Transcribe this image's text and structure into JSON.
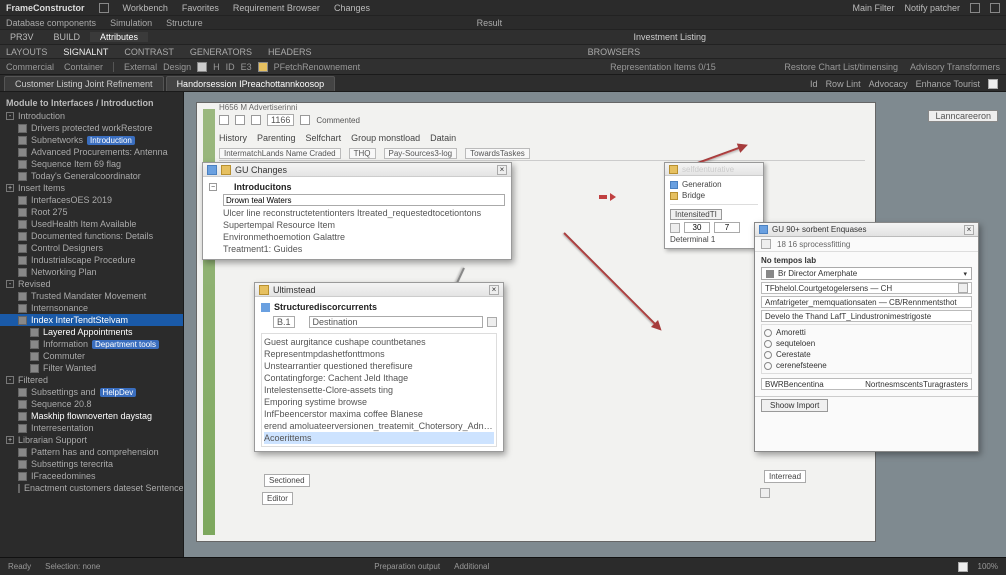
{
  "menubar": {
    "app": "FrameConstructor",
    "items": [
      "Workbench",
      "Favorites",
      "Requirement Browser",
      "Changes"
    ],
    "right": [
      "Main Filter",
      "Notify patcher"
    ]
  },
  "ribbon": {
    "items": [
      "Database components",
      "Simulation",
      "Structure"
    ],
    "center": "Result"
  },
  "secondary": {
    "leftTabs": [
      "PR3V",
      "BUILD",
      "Attributes"
    ],
    "rightLabel": "Investment Listing"
  },
  "catbar": {
    "items": [
      "LAYOUTS",
      "SIGNALNT",
      "CONTRAST",
      "GENERATORS",
      "HEADERS"
    ],
    "center": "BROWSERS"
  },
  "toolrow": {
    "left": [
      "Commercial",
      "Container"
    ],
    "center": [
      "External",
      "Design",
      "H",
      "ID",
      "E3",
      "PFetchRenownement"
    ],
    "mid": "Representation Items 0/15",
    "right": [
      "Restore Chart List/timensing",
      "Advisory Transformers"
    ]
  },
  "tabstrip": {
    "tabs": [
      {
        "label": "Customer Listing Joint Refinement",
        "active": false
      },
      {
        "label": "Handorsession IPreachottannkoosop",
        "active": true
      }
    ],
    "rightlinks": [
      "Id",
      "Row Lint",
      "Advocacy",
      "Enhance Tourist"
    ]
  },
  "leftpanel": {
    "title": "Module to Interfaces / Introduction",
    "rows": [
      {
        "t": "section",
        "label": "Introduction",
        "expand": "-"
      },
      {
        "t": "row",
        "indent": 1,
        "label": "Drivers protected workRestore"
      },
      {
        "t": "row",
        "indent": 1,
        "label": "Subnetworks",
        "badge": "Introduction"
      },
      {
        "t": "row",
        "indent": 1,
        "label": "Advanced Procurements: Antenna"
      },
      {
        "t": "row",
        "indent": 1,
        "label": "Sequence Item   69 flag"
      },
      {
        "t": "row",
        "indent": 1,
        "label": "Today's Generalcoordinator"
      },
      {
        "t": "section",
        "label": "Insert Items",
        "expand": "+"
      },
      {
        "t": "row",
        "indent": 1,
        "label": "InterfacesOES 2019"
      },
      {
        "t": "row",
        "indent": 1,
        "label": "Root 275"
      },
      {
        "t": "row",
        "indent": 1,
        "label": "UsedHealth Item Available"
      },
      {
        "t": "row",
        "indent": 1,
        "label": "Documented functions: Details"
      },
      {
        "t": "row",
        "indent": 1,
        "label": "Control Designers"
      },
      {
        "t": "row",
        "indent": 1,
        "label": "Industrialscape Procedure"
      },
      {
        "t": "row",
        "indent": 1,
        "label": "Networking Plan"
      },
      {
        "t": "section",
        "label": "Revised",
        "expand": "-"
      },
      {
        "t": "row",
        "indent": 1,
        "label": "Trusted Mandater Movement"
      },
      {
        "t": "row",
        "indent": 1,
        "label": "Internsonance"
      },
      {
        "t": "row",
        "indent": 1,
        "sel": true,
        "label": "Index  InterTendtStelvam"
      },
      {
        "t": "row",
        "indent": 2,
        "hl": true,
        "label": "Layered   Appointments"
      },
      {
        "t": "row",
        "indent": 2,
        "label": "Information",
        "badge": "Department tools"
      },
      {
        "t": "row",
        "indent": 2,
        "label": "Commuter"
      },
      {
        "t": "row",
        "indent": 2,
        "label": "Filter Wanted"
      },
      {
        "t": "section",
        "label": "Filtered",
        "expand": "-"
      },
      {
        "t": "row",
        "indent": 1,
        "label": "Subsettings and",
        "badge": "HelpDev"
      },
      {
        "t": "row",
        "indent": 1,
        "label": "Sequence  20.8"
      },
      {
        "t": "row",
        "indent": 1,
        "label": "Maskhip flownoverten daystag",
        "hl": true
      },
      {
        "t": "row",
        "indent": 1,
        "label": "Interresentation"
      },
      {
        "t": "section",
        "label": "Librarian Support",
        "expand": "+"
      },
      {
        "t": "row",
        "indent": 1,
        "label": "Pattern has and comprehension"
      },
      {
        "t": "row",
        "indent": 1,
        "label": "Subsettings terecrita"
      },
      {
        "t": "row",
        "indent": 1,
        "label": "IFraceedomines"
      },
      {
        "t": "row",
        "indent": 1,
        "label": "Enactment customers dateset Sentence"
      }
    ]
  },
  "document": {
    "title": "H656 M Advertiserinni",
    "toolbarItems": [
      "",
      "",
      "",
      "1166",
      "",
      "Commented"
    ],
    "menubar": [
      "History",
      "Parenting",
      "Selfchart",
      "Group monstload",
      "Datain"
    ],
    "subbar": [
      "IntermatchLands Name Craded",
      "THQ",
      "Pay-Sources3-log",
      "TowardsTaskes"
    ]
  },
  "popup1": {
    "title": "GU Changes",
    "heading": "Introducitons",
    "field": "Drown teal Waters",
    "lines": [
      "Ulcer line reconstructetentionters   Itreated_requestedtocetiontons",
      "Supertempal Resource Item",
      "Environmethoemotion Galattre",
      "Treatment1: Guides"
    ]
  },
  "popup2": {
    "title": "Ultimstead",
    "heading": "Structurediscorcurrents",
    "controlLabel": "B.1",
    "control2": "Destination",
    "items": [
      "Guest aurgitance cushape countbetanes",
      "Representmpdashetfonttmons",
      "Unstearrantier questioned therefisure",
      "Contatingforge: Cachent Jeld Ithage",
      "Intelestensette-Clore-assets ting",
      "Emporing systime browse",
      "InfFbeencerstor maxima coffee Blanese",
      "erend amoluateerversionen_treatemit_Chotersory_Adnet answers",
      "Acoerittems"
    ],
    "buttons": [
      "Sectioned",
      "Editor"
    ]
  },
  "midPopup": {
    "title": "selfdenturative",
    "sub": "Generation",
    "line": "Bridge",
    "btn": "IntensitedTI",
    "fields": [
      {
        "v": "30"
      },
      {
        "v": "7"
      }
    ],
    "coord": "Determinal  1"
  },
  "bigpanel": {
    "title": "GU 90+ sorbent Enquases",
    "sub": "18  16   sprocessfitting",
    "section": "No tempos lab",
    "dropdown1": "Br  Director Amerphate",
    "bar1a": "TFbhelol.Courtgetogelersens — CH",
    "bar1b": "Amfatrigeter_memquationsaten — CB/Rennmentsthot",
    "bar2": "Develo the Thand LafT_Lindustronimestrigoste",
    "opts": [
      "Amoretti",
      "sequteloen",
      "Cerestate",
      "cerenefsteene"
    ],
    "footer1": "BWRBencentina",
    "footerField": "NortnesmscentsTuragrasters",
    "okBtn": "Shoow Import"
  },
  "miniTags": {
    "t1": "Interread"
  },
  "statusbar": {
    "left": [
      "Ready",
      "Selection: none"
    ],
    "center": [
      "Preparation output",
      "Additional"
    ],
    "right": [
      "",
      "100%"
    ]
  }
}
